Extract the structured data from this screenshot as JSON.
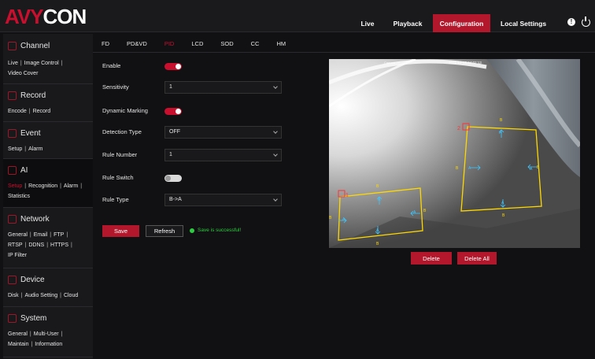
{
  "brand": {
    "logo_a": "AVY",
    "logo_b": "CON"
  },
  "nav": {
    "live": "Live",
    "playback": "Playback",
    "configuration": "Configuration",
    "local_settings": "Local Settings"
  },
  "top_icons": {
    "info": "info-icon",
    "power": "power-icon"
  },
  "sidebar": {
    "channel": {
      "title": "Channel",
      "links": [
        "Live",
        "Image Control",
        "Video Cover"
      ]
    },
    "record": {
      "title": "Record",
      "links": [
        "Encode",
        "Record"
      ]
    },
    "event": {
      "title": "Event",
      "links": [
        "Setup",
        "Alarm"
      ]
    },
    "ai": {
      "title": "AI",
      "links": [
        "Setup",
        "Recognition",
        "Alarm",
        "Statistics"
      ]
    },
    "network": {
      "title": "Network",
      "links": [
        "General",
        "Email",
        "FTP",
        "RTSP",
        "DDNS",
        "HTTPS",
        "IP Filter"
      ]
    },
    "device": {
      "title": "Device",
      "links": [
        "Disk",
        "Audio Setting",
        "Cloud"
      ]
    },
    "system": {
      "title": "System",
      "links": [
        "General",
        "Multi-User",
        "Maintain",
        "Information"
      ]
    }
  },
  "tabs": [
    "FD",
    "PD&VD",
    "PID",
    "LCD",
    "SOD",
    "CC",
    "HM"
  ],
  "form": {
    "enable_label": "Enable",
    "sensitivity_label": "Sensitivity",
    "sensitivity_value": "1",
    "dynamic_marking_label": "Dynamic Marking",
    "detection_type_label": "Detection Type",
    "detection_type_value": "OFF",
    "rule_number_label": "Rule Number",
    "rule_number_value": "1",
    "rule_switch_label": "Rule Switch",
    "rule_type_label": "Rule Type",
    "rule_type_value": "B->A",
    "enable_on": true,
    "dynamic_marking_on": true,
    "rule_switch_on": false
  },
  "actions": {
    "save": "Save",
    "refresh": "Refresh",
    "status": "Save is successful!"
  },
  "video": {
    "camera_name": "Camera",
    "timestamp": "2021-12-18 04:02:13",
    "rule1_number": "1",
    "rule2_number": "2",
    "a_label": "A",
    "b_label": "B",
    "delete": "Delete",
    "delete_all": "Delete All"
  },
  "colors": {
    "accent": "#c8102e",
    "rule_line": "#ffd800",
    "arrow": "#3fc8ff",
    "success": "#2ecc40"
  }
}
